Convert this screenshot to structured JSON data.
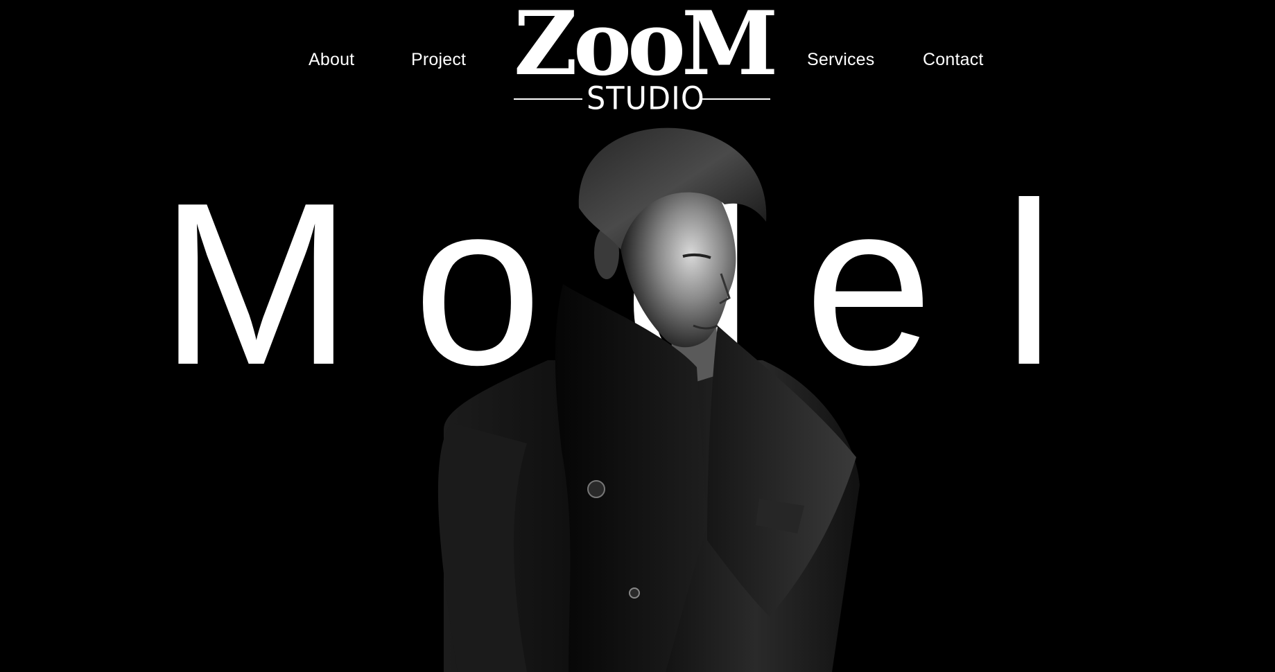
{
  "nav": {
    "left": [
      {
        "label": "About"
      },
      {
        "label": "Project"
      }
    ],
    "right": [
      {
        "label": "Services"
      },
      {
        "label": "Contact"
      }
    ]
  },
  "logo": {
    "wordmark": "ZooM",
    "subtitle": "STUDIO"
  },
  "hero": {
    "letters": [
      "M",
      "o",
      "d",
      "e",
      "l"
    ]
  },
  "colors": {
    "background": "#000000",
    "text": "#ffffff"
  }
}
